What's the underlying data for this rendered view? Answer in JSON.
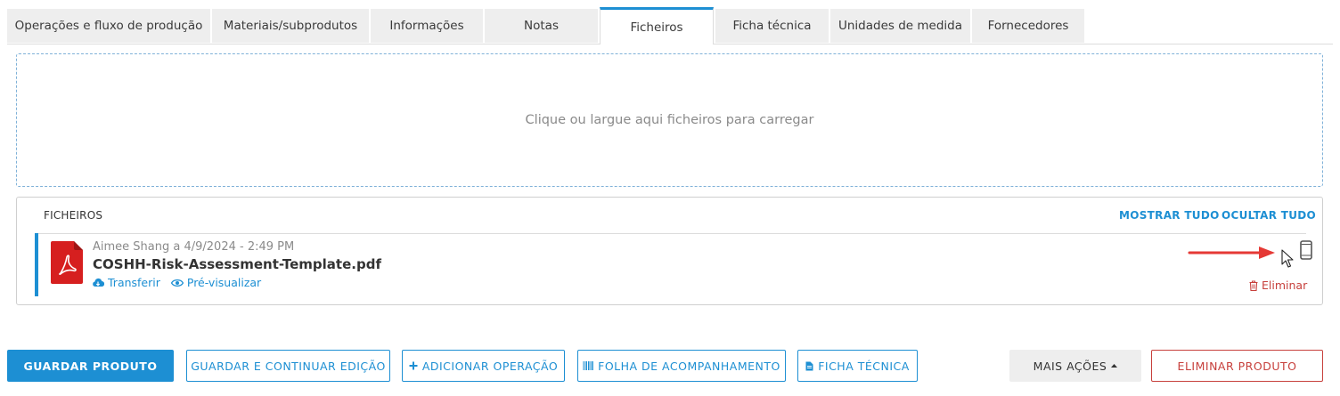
{
  "tabs": [
    {
      "label": "Operações e fluxo de produção",
      "active": false
    },
    {
      "label": "Materiais/subprodutos",
      "active": false
    },
    {
      "label": "Informações",
      "active": false
    },
    {
      "label": "Notas",
      "active": false
    },
    {
      "label": "Ficheiros",
      "active": true
    },
    {
      "label": "Ficha técnica",
      "active": false
    },
    {
      "label": "Unidades de medida",
      "active": false
    },
    {
      "label": "Fornecedores",
      "active": false
    }
  ],
  "dropzone": {
    "text": "Clique ou largue aqui ficheiros para carregar"
  },
  "files_panel": {
    "title": "FICHEIROS",
    "show_all": "MOSTRAR TUDO",
    "hide_all": "OCULTAR TUDO",
    "files": [
      {
        "meta": "Aimee Shang a 4/9/2024 - 2:49 PM",
        "name": "COSHH-Risk-Assessment-Template.pdf",
        "download_label": "Transferir",
        "preview_label": "Pré-visualizar",
        "delete_label": "Eliminar",
        "icon": "pdf-file-icon"
      }
    ]
  },
  "buttons": {
    "save": "GUARDAR PRODUTO",
    "save_continue": "GUARDAR E CONTINUAR EDIÇÃO",
    "add_operation": "ADICIONAR OPERAÇÃO",
    "tracking_sheet": "FOLHA DE ACOMPANHAMENTO",
    "tech_sheet": "FICHA TÉCNICA",
    "more_actions": "MAIS AÇÕES",
    "delete_product": "ELIMINAR PRODUTO"
  },
  "colors": {
    "accent": "#1d8fd3",
    "danger": "#c7403c",
    "pdf_red": "#d61f1f",
    "annotation_arrow": "#e53935"
  }
}
